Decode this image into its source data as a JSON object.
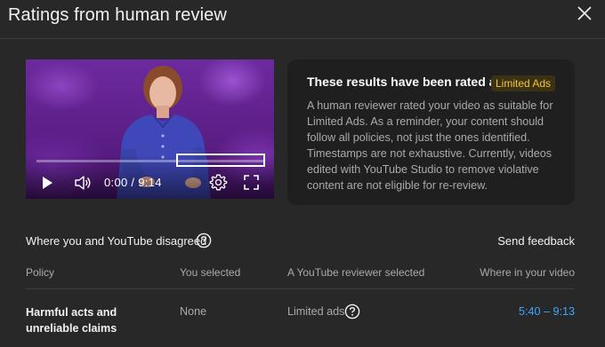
{
  "dialog": {
    "title": "Ratings from human review"
  },
  "video": {
    "time_display": "0:00 / 9:14",
    "progress_fraction": 0.0
  },
  "result": {
    "heading": "These results have been rated as",
    "badge": "Limited Ads",
    "description": "A human reviewer rated your video as suitable for Limited Ads. As a reminder, your content should follow all policies, not just the ones identified. Timestamps are not exhaustive. Currently, videos edited with YouTube Studio to remove violative content are not eligible for re-review."
  },
  "disagreement": {
    "title": "Where you and YouTube disagreed",
    "send_feedback": "Send feedback",
    "columns": [
      "Policy",
      "You selected",
      "A YouTube reviewer selected",
      "Where in your video"
    ],
    "rows": [
      {
        "policy": "Harmful acts and unreliable claims",
        "you_selected": "None",
        "reviewer_selected": "Limited ads",
        "where": "5:40 – 9:13"
      }
    ]
  },
  "colors": {
    "background": "#282828",
    "card": "#1f1f1f",
    "badge_text": "#f2c33a",
    "badge_bg": "#3a3213",
    "link": "#3ea6ff",
    "video_purple": "#5b1d86"
  },
  "icons": [
    "close-icon",
    "play-icon",
    "volume-icon",
    "settings-icon",
    "fullscreen-icon",
    "help-icon"
  ]
}
